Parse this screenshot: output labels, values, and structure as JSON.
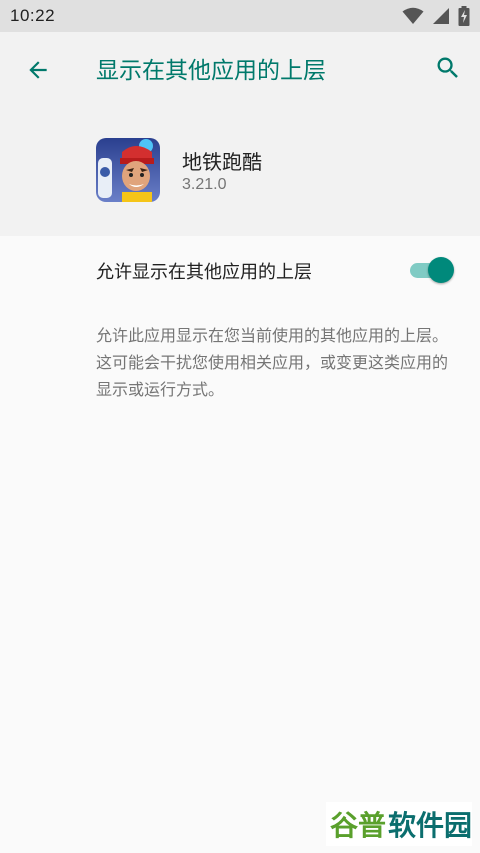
{
  "status_bar": {
    "time": "10:22",
    "icons": [
      "wifi-icon",
      "cell-signal-icon",
      "battery-charging-icon"
    ]
  },
  "app_bar": {
    "title": "显示在其他应用的上层",
    "back_icon": "arrow-back-icon",
    "search_icon": "search-icon",
    "accent_color": "#00796b"
  },
  "app_info": {
    "name": "地铁跑酷",
    "version": "3.21.0"
  },
  "permission": {
    "label": "允许显示在其他应用的上层",
    "enabled": true,
    "description": "允许此应用显示在您当前使用的其他应用的上层。这可能会干扰您使用相关应用，或变更这类应用的显示或运行方式。"
  },
  "watermark": {
    "text_part1": "谷普",
    "text_part2": "软件园"
  },
  "colors": {
    "switch_thumb": "#00897b",
    "switch_track": "#80cbc4",
    "watermark_green": "#5aa02c",
    "watermark_teal": "#0b6e6e"
  }
}
